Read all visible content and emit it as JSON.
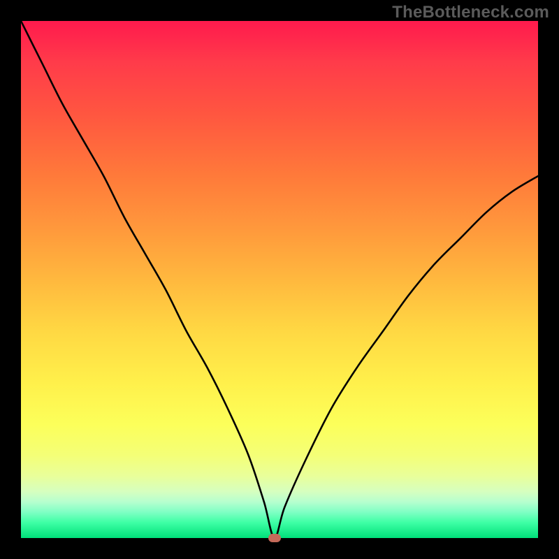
{
  "watermark": "TheBottleneck.com",
  "colors": {
    "frame_bg": "#000000",
    "watermark_text": "#5b5b5b",
    "curve_stroke": "#000000",
    "marker_fill": "#c56a5a",
    "gradient_stops": [
      "#ff1a4d",
      "#ff3b4a",
      "#ff5640",
      "#ff7a3a",
      "#ff983c",
      "#ffb83e",
      "#ffd843",
      "#fff04b",
      "#fcff5a",
      "#f4ff77",
      "#e9ff9a",
      "#d6ffbf",
      "#b6ffcf",
      "#7fffc4",
      "#3effa5",
      "#00e07a"
    ]
  },
  "chart_data": {
    "type": "line",
    "title": "",
    "xlabel": "",
    "ylabel": "",
    "xlim": [
      0,
      100
    ],
    "ylim": [
      0,
      100
    ],
    "grid": false,
    "legend": false,
    "description": "V-shaped bottleneck curve on a vertical rainbow gradient. Left branch descends steeply from the top-left, both branches meet at a sharp minimum near x≈49, y≈0, then the right branch rises to about 70% height at the right edge. The small capsule marker sits at the minimum.",
    "series": [
      {
        "name": "bottleneck-curve",
        "x": [
          0,
          4,
          8,
          12,
          16,
          20,
          24,
          28,
          32,
          36,
          40,
          44,
          47,
          49,
          51,
          55,
          60,
          65,
          70,
          75,
          80,
          85,
          90,
          95,
          100
        ],
        "y": [
          100,
          92,
          84,
          77,
          70,
          62,
          55,
          48,
          40,
          33,
          25,
          16,
          7,
          0,
          6,
          15,
          25,
          33,
          40,
          47,
          53,
          58,
          63,
          67,
          70
        ]
      }
    ],
    "marker": {
      "x": 49,
      "y": 0
    }
  }
}
